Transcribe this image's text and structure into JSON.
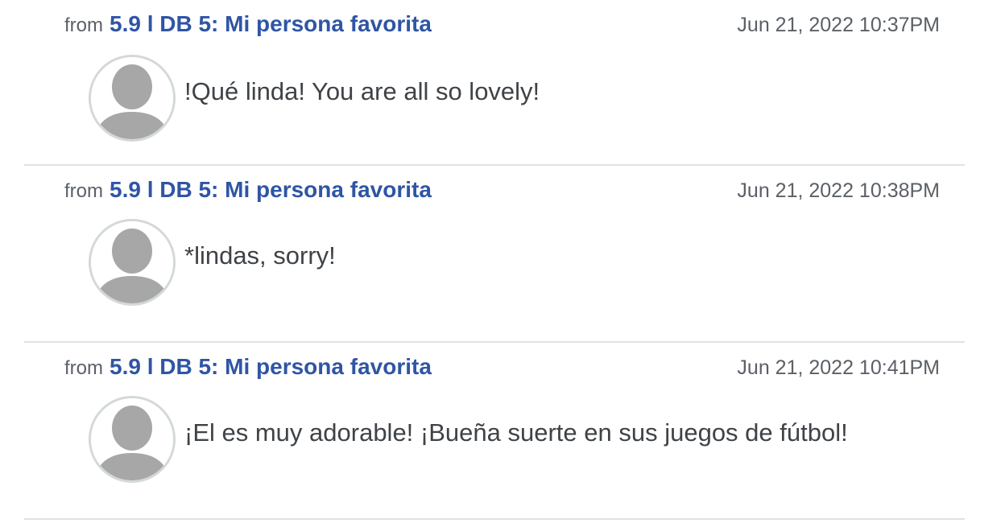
{
  "comments": [
    {
      "from_label": "from",
      "course": "5.9 l DB 5: Mi persona favorita",
      "timestamp": "Jun 21, 2022 10:37PM",
      "message": "!Qué linda! You are all so lovely!"
    },
    {
      "from_label": "from",
      "course": "5.9 l DB 5: Mi persona favorita",
      "timestamp": "Jun 21, 2022 10:38PM",
      "message": "*lindas, sorry!"
    },
    {
      "from_label": "from",
      "course": "5.9 l DB 5: Mi persona favorita",
      "timestamp": "Jun 21, 2022 10:41PM",
      "message": "¡El es muy adorable! ¡Bueña suerte en sus juegos de fútbol!"
    }
  ],
  "icons": {
    "avatar": "default-user-avatar-icon"
  },
  "colors": {
    "link": "#2f55a4",
    "muted_text": "#5b6066",
    "body_text": "#3f4347",
    "divider": "#dfe2e2",
    "avatar_border": "#d3d9d8",
    "avatar_silhouette": "#a7a7a7"
  }
}
